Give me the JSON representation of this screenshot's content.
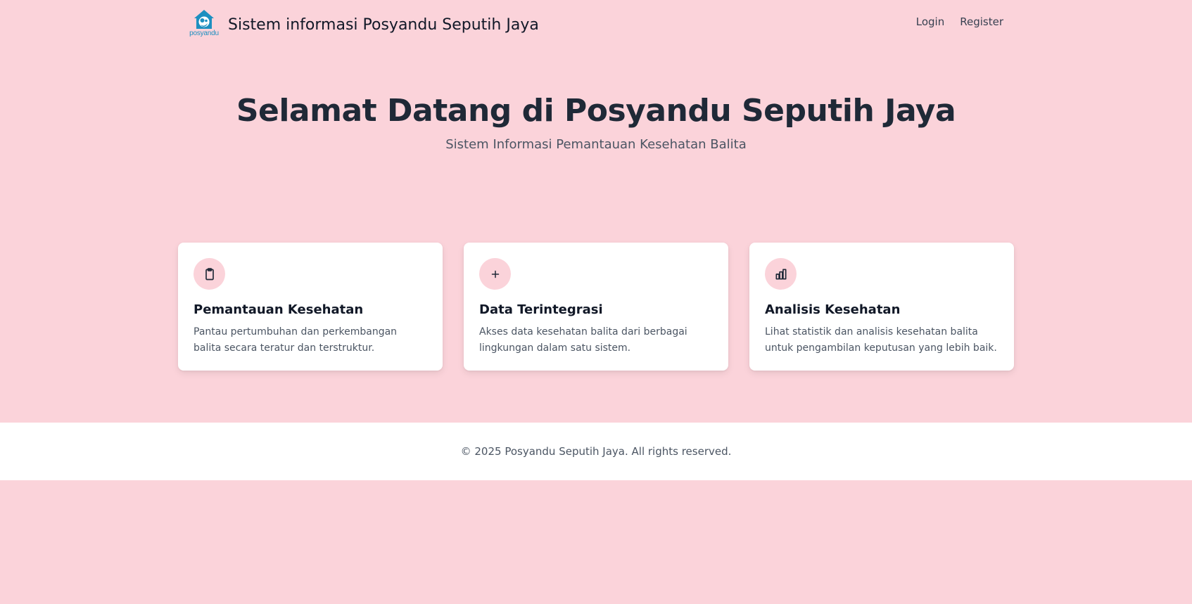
{
  "header": {
    "logo_text": "posyandu",
    "title": "Sistem informasi Posyandu Seputih Jaya",
    "nav": [
      {
        "label": "Login"
      },
      {
        "label": "Register"
      }
    ]
  },
  "hero": {
    "title": "Selamat Datang di Posyandu Seputih Jaya",
    "subtitle": "Sistem Informasi Pemantauan Kesehatan Balita"
  },
  "features": [
    {
      "icon": "clipboard-icon",
      "title": "Pemantauan Kesehatan",
      "description": "Pantau pertumbuhan dan perkembangan balita secara teratur dan terstruktur."
    },
    {
      "icon": "plus-icon",
      "title": "Data Terintegrasi",
      "description": "Akses data kesehatan balita dari berbagai lingkungan dalam satu sistem."
    },
    {
      "icon": "bar-chart-icon",
      "title": "Analisis Kesehatan",
      "description": "Lihat statistik dan analisis kesehatan balita untuk pengambilan keputusan yang lebih baik."
    }
  ],
  "footer": {
    "copyright": "© 2025 Posyandu Seputih Jaya. All rights reserved."
  },
  "colors": {
    "background": "#fbd3da",
    "card": "#ffffff",
    "icon_bg": "#fbd3da",
    "logo": "#1d8fc0",
    "text_dark": "#1f2937",
    "text_muted": "#4b5563"
  }
}
